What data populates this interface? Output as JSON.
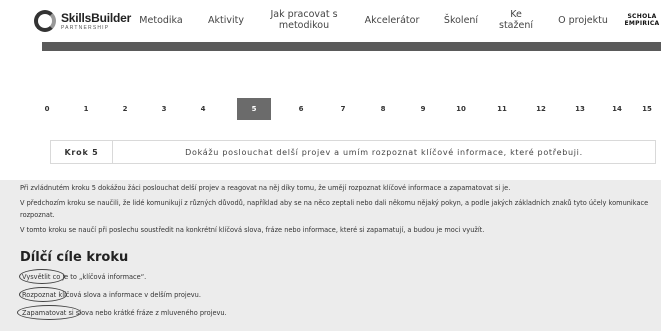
{
  "header": {
    "logo": {
      "main": "SkillsBuilder",
      "sub": "PARTNERSHIP"
    },
    "nav": [
      {
        "label": "Metodika"
      },
      {
        "label": "Aktivity"
      },
      {
        "label": "Jak pracovat s metodikou"
      },
      {
        "label": "Akcelerátor"
      },
      {
        "label": "Školení"
      },
      {
        "label": "Ke stažení"
      },
      {
        "label": "O projektu"
      },
      {
        "label": "SCHOLA EMPIRICA"
      }
    ]
  },
  "steps": {
    "items": [
      "0",
      "1",
      "2",
      "3",
      "4",
      "5",
      "6",
      "7",
      "8",
      "9",
      "10",
      "11",
      "12",
      "13",
      "14",
      "15"
    ],
    "active": "5"
  },
  "krok": {
    "label": "Krok 5",
    "text": "Dokážu poslouchat delší projev a umím rozpoznat klíčové informace, které potřebuji."
  },
  "content": {
    "paragraphs": [
      "Při zvládnutém kroku 5 dokážou žáci poslouchat delší projev a reagovat na něj díky tomu, že umějí rozpoznat klíčové informace a zapamatovat si je.",
      "V předchozím kroku se naučili, že lidé komunikují z různých důvodů, například aby se na něco zeptali nebo dali někomu nějaký pokyn, a podle jakých základních znaků tyto účely komunikace rozpoznat.",
      "V tomto kroku se naučí při poslechu soustředit na konkrétní klíčová slova, fráze nebo informace, které si zapamatují, a budou je moci využít."
    ],
    "section_title": "Dílčí cíle kroku",
    "goals": [
      {
        "highlight": "Vysvětlit",
        "rest": " co je to „klíčová informace“."
      },
      {
        "highlight": "Rozpoznat",
        "rest": " klíčová slova a informace v delším projevu."
      },
      {
        "highlight": "Zapamatovat si",
        "rest": " slova nebo krátké fráze z mluveného projevu."
      }
    ]
  }
}
